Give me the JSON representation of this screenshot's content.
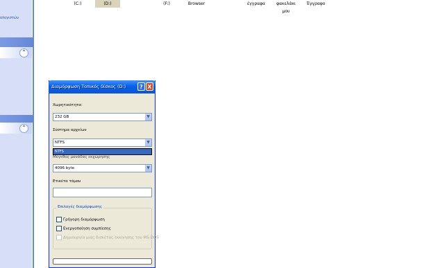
{
  "drives": [
    {
      "label": "(C:)",
      "selected": false
    },
    {
      "label": "(D:)",
      "selected": true
    },
    {
      "label": "(F:)",
      "selected": false
    },
    {
      "label": "Browser",
      "selected": false
    },
    {
      "label": "έγγραφα",
      "selected": false
    },
    {
      "label": "φακελάκι μου",
      "selected": false
    },
    {
      "label": "Έγγραφο",
      "selected": false
    }
  ],
  "taskpane": {
    "top_text": "ολογιστών",
    "chevron_icon": "chevron-up-double-icon"
  },
  "dialog": {
    "title": "Διαμόρφωση Τοπικός δίσκος (D:)",
    "help_label": "?",
    "close_label": "X",
    "capacity_label": "Χωρητικότητα:",
    "capacity_value": "232 GB",
    "filesystem_label": "Σύστημα αρχείων",
    "filesystem_value": "NTFS",
    "filesystem_dropdown_item": "NTFS",
    "allocation_label": "Μέγεθος μονάδας εκχώρησης",
    "allocation_value": "4096 byte",
    "volume_label": "Ετικέτα τόμου",
    "volume_value": "",
    "options_title": "Επιλογές διαμόρφωσης",
    "quick_format_label": "Γρήγορη διαμόρφωση",
    "compression_label": "Ενεργοποίηση συμπίεσης",
    "msdos_label": "Δημιουργία μιας δισκέτας εκκίνησης του MS-DOS"
  },
  "colors": {
    "titlebar": "#0a5fe8",
    "dialog_bg": "#ece9d8",
    "selection": "#316ac5",
    "taskpane": "#6f8fdc"
  }
}
